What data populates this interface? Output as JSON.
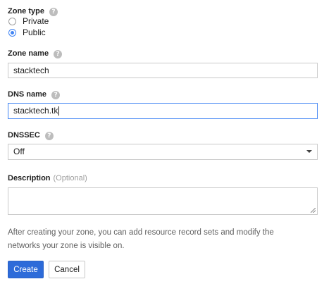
{
  "zone_type": {
    "label": "Zone type",
    "help_icon": "help-circle-icon",
    "options": [
      {
        "label": "Private",
        "checked": false
      },
      {
        "label": "Public",
        "checked": true
      }
    ]
  },
  "zone_name": {
    "label": "Zone name",
    "help_icon": "help-circle-icon",
    "value": "stacktech"
  },
  "dns_name": {
    "label": "DNS name",
    "help_icon": "help-circle-icon",
    "value": "stacktech.tk"
  },
  "dnssec": {
    "label": "DNSSEC",
    "help_icon": "help-circle-icon",
    "selected": "Off"
  },
  "description": {
    "label": "Description",
    "optional_label": "(Optional)",
    "value": ""
  },
  "info": {
    "line1": "After creating your zone, you can add resource record sets and modify the",
    "line2": "networks your zone is visible on."
  },
  "buttons": {
    "create": "Create",
    "cancel": "Cancel"
  },
  "colors": {
    "accent": "#4285f4",
    "primary_button": "#2d6bd9",
    "muted_text": "#616161"
  }
}
